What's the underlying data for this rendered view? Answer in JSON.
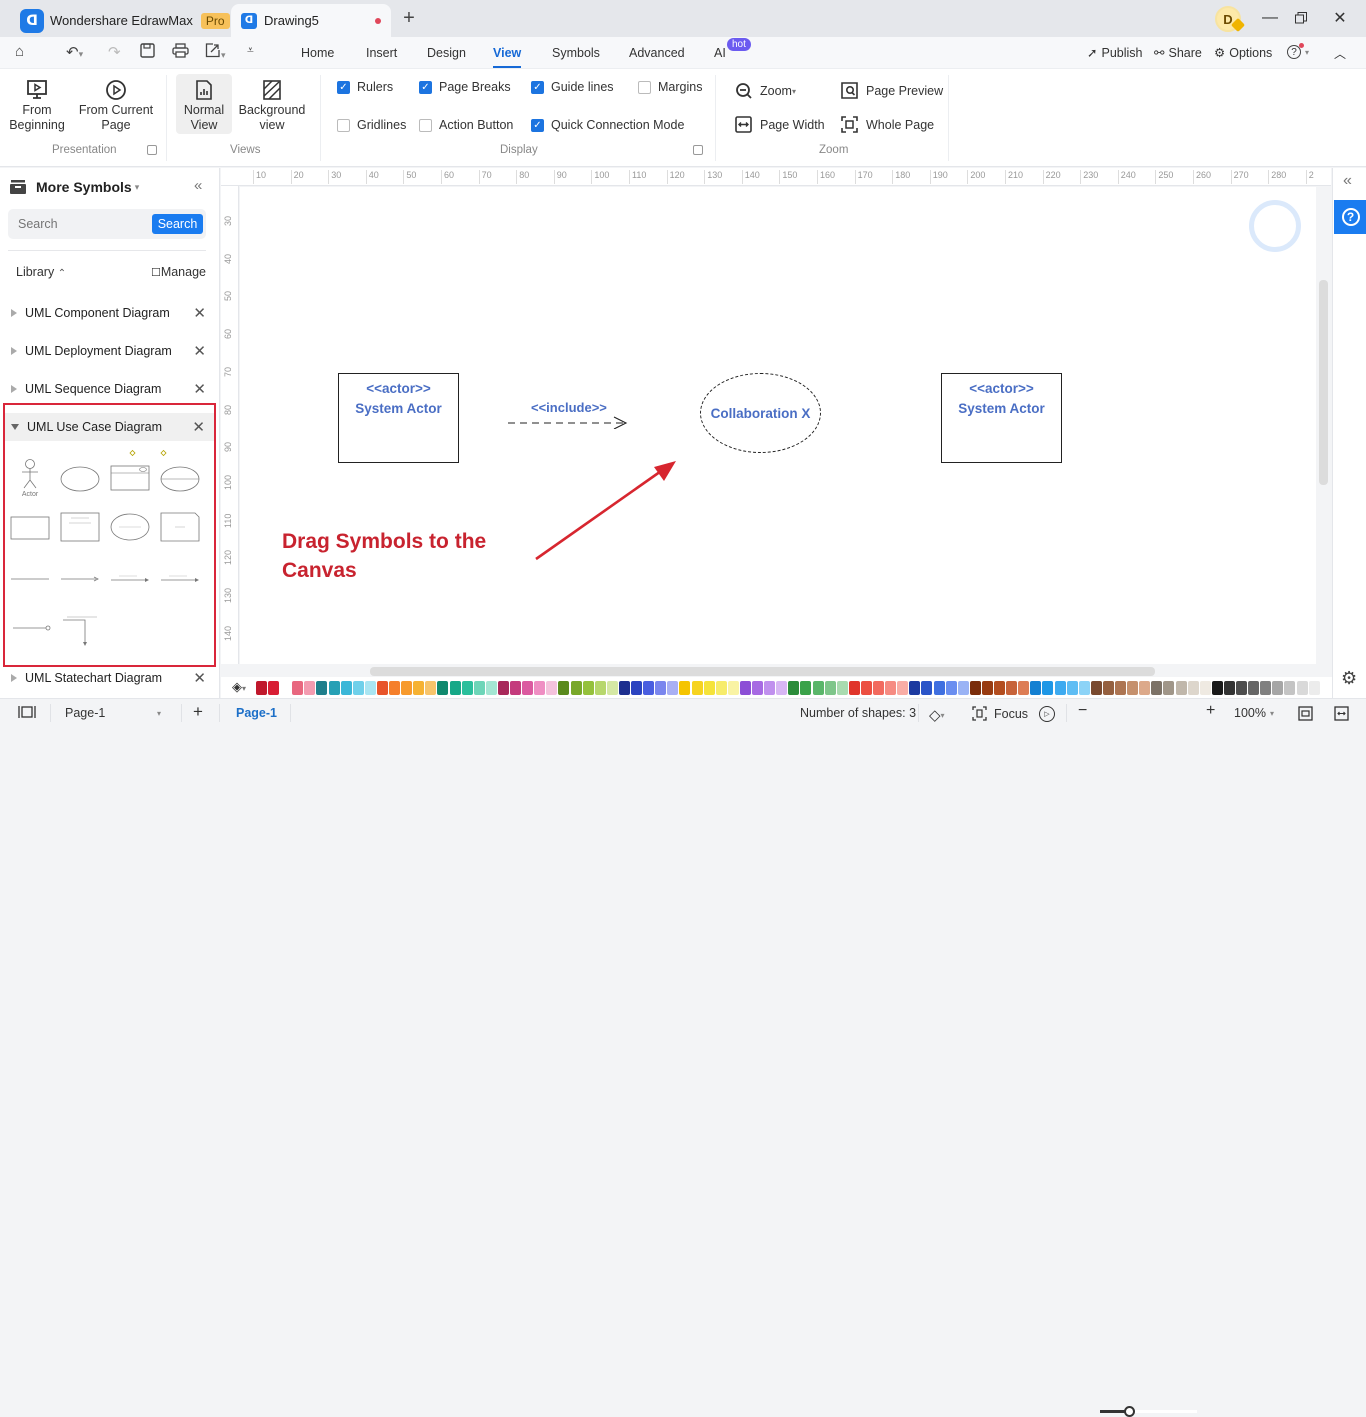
{
  "titlebar": {
    "app_name": "Wondershare EdrawMax",
    "plan_badge": "Pro",
    "document_tab": "Drawing5",
    "new_tab_icon": "+",
    "avatar_initial": "D"
  },
  "menubar": {
    "tabs": [
      "Home",
      "Insert",
      "Design",
      "View",
      "Symbols",
      "Advanced",
      "AI"
    ],
    "active_tab": "View",
    "ai_badge": "hot",
    "publish": "Publish",
    "share": "Share",
    "options": "Options"
  },
  "ribbon": {
    "presentation": {
      "from_beginning": [
        "From",
        "Beginning"
      ],
      "from_current": [
        "From Current",
        "Page"
      ],
      "label": "Presentation"
    },
    "views": {
      "normal": [
        "Normal",
        "View"
      ],
      "background": [
        "Background",
        "view"
      ],
      "label": "Views",
      "active": "Normal View"
    },
    "display": {
      "label": "Display",
      "options": [
        {
          "label": "Rulers",
          "checked": true
        },
        {
          "label": "Page Breaks",
          "checked": true
        },
        {
          "label": "Guide lines",
          "checked": true
        },
        {
          "label": "Margins",
          "checked": false
        },
        {
          "label": "Gridlines",
          "checked": false
        },
        {
          "label": "Action Button",
          "checked": false
        },
        {
          "label": "Quick Connection Mode",
          "checked": true
        }
      ]
    },
    "zoom": {
      "label": "Zoom",
      "zoom": "Zoom",
      "page_preview": "Page Preview",
      "page_width": "Page Width",
      "whole_page": "Whole Page"
    }
  },
  "left_panel": {
    "title": "More Symbols",
    "search_placeholder": "Search",
    "search_button": "Search",
    "library_label": "Library",
    "manage_label": "Manage",
    "categories": [
      {
        "name": "UML Component Diagram",
        "expanded": false
      },
      {
        "name": "UML Deployment Diagram",
        "expanded": false
      },
      {
        "name": "UML Sequence Diagram",
        "expanded": false
      },
      {
        "name": "UML Use Case Diagram",
        "expanded": true
      },
      {
        "name": "UML Statechart Diagram",
        "expanded": false
      }
    ],
    "symbols": [
      "Actor",
      "Use Case",
      "Use Case Extension Points",
      "Use Case Extension Points Ellipse",
      "System Boundary",
      "System Actor",
      "Collaboration X",
      "Note",
      "Association",
      "Navigable Association",
      "Include",
      "Extend",
      "Interface Association",
      "Dependency"
    ],
    "actor_caption": "Actor"
  },
  "ruler": {
    "h_ticks": [
      "10",
      "20",
      "30",
      "40",
      "50",
      "60",
      "70",
      "80",
      "90",
      "100",
      "110",
      "120",
      "130",
      "140",
      "150",
      "160",
      "170",
      "180",
      "190",
      "200",
      "210",
      "220",
      "230",
      "240",
      "250",
      "260",
      "270",
      "280",
      "2"
    ],
    "v_ticks": [
      "30",
      "40",
      "50",
      "60",
      "70",
      "80",
      "90",
      "100",
      "110",
      "120",
      "130",
      "140"
    ]
  },
  "canvas": {
    "actor1": {
      "stereotype": "<<actor>>",
      "name": "System Actor"
    },
    "include_label": "<<include>>",
    "collaboration": "Collaboration X",
    "actor2": {
      "stereotype": "<<actor>>",
      "name": "System Actor"
    },
    "annotation": "Drag Symbols to the Canvas",
    "annotation_color": "#c8232f"
  },
  "palette": {
    "colors": [
      "#c0182c",
      "#d81e34",
      "#e8677f",
      "#f39bb0",
      "#1f7f8c",
      "#26a0b5",
      "#3bb7d8",
      "#6fd0ea",
      "#a9e5f2",
      "#e8542a",
      "#f57f2b",
      "#f79a2d",
      "#f6b233",
      "#f7c46b",
      "#10896e",
      "#16a888",
      "#2abf9c",
      "#6dd5b8",
      "#a4e6d3",
      "#a8285a",
      "#c43b7d",
      "#db5aa0",
      "#ef8ec3",
      "#f4c2dc",
      "#5a8a1d",
      "#79a82a",
      "#95c13c",
      "#b7d76d",
      "#d5e8a5",
      "#1d2f8f",
      "#2b43c0",
      "#4a5ee0",
      "#7a86ee",
      "#a9b0f4",
      "#f5c400",
      "#f6d320",
      "#f5e33a",
      "#f7ec6a",
      "#f9f3a4",
      "#8c4fd6",
      "#a76ae3",
      "#c090ee",
      "#d7b6f4",
      "#2b8c3a",
      "#3aa24a",
      "#5ab66a",
      "#7ec68a",
      "#a9dbb0",
      "#e0352b",
      "#ec4f42",
      "#f26a5f",
      "#f68b82",
      "#f9ada6",
      "#1c3aa0",
      "#2a54c8",
      "#3f6fe0",
      "#6a8ef0",
      "#9ab3f5",
      "#7a2c0a",
      "#983b11",
      "#b34d1f",
      "#c7633a",
      "#dd7d55",
      "#1480d2",
      "#1e97e6",
      "#3daaf0",
      "#5ebdf4",
      "#8cd3f7",
      "#7a4a2f",
      "#95603f",
      "#ad7552",
      "#c5906d",
      "#dca98a",
      "#7c7267",
      "#a09689",
      "#c0b7ab",
      "#ddd6cc",
      "#efeae2",
      "#1a1a1a",
      "#333333",
      "#4d4d4d",
      "#666666",
      "#808080",
      "#a6a6a6",
      "#c4c4c4",
      "#d9d9d9",
      "#ececec"
    ]
  },
  "statusbar": {
    "page_selector": "Page-1",
    "active_page": "Page-1",
    "shapes_count": "Number of shapes: 3",
    "focus": "Focus",
    "zoom_level": "100%",
    "zoom_slider_fraction": 0.3
  }
}
